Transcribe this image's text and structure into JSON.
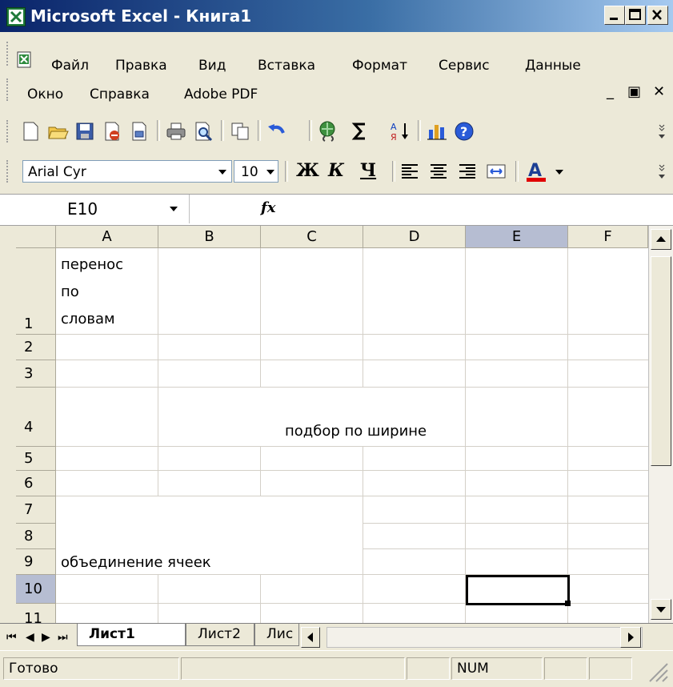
{
  "window": {
    "title": "Microsoft Excel - Книга1"
  },
  "menu": {
    "items": [
      "Файл",
      "Правка",
      "Вид",
      "Вставка",
      "Формат",
      "Сервис",
      "Данные"
    ],
    "items_row2": [
      "Окно",
      "Справка",
      "Adobe PDF"
    ]
  },
  "formatting": {
    "font_name": "Arial Cyr",
    "font_size": "10"
  },
  "formula_bar": {
    "name_box": "E10",
    "fx_label": "fx",
    "formula": ""
  },
  "sheet": {
    "columns": [
      "A",
      "B",
      "C",
      "D",
      "E",
      "F"
    ],
    "rows": [
      "1",
      "2",
      "3",
      "4",
      "5",
      "6",
      "7",
      "8",
      "9",
      "10",
      "11"
    ],
    "selected_column": "E",
    "selected_row": "10",
    "active_cell": "E10",
    "cells": {
      "A1_line1": "перенос",
      "A1_line2": "по",
      "A1_line3": "словам",
      "C4": "подбор по ширине",
      "A7_merged": "объединение ячеек"
    }
  },
  "tabs": {
    "items": [
      "Лист1",
      "Лист2",
      "Лис"
    ],
    "active": "Лист1"
  },
  "status": {
    "ready": "Готово",
    "num": "NUM"
  },
  "icons": {
    "app": "excel-icon",
    "new": "new-document-icon",
    "open": "open-folder-icon",
    "save": "save-icon",
    "permission": "permission-icon",
    "print": "print-icon",
    "print_preview": "print-preview-icon",
    "copy": "copy-icon",
    "undo": "undo-icon",
    "hyperlink": "hyperlink-icon",
    "autosum": "autosum-icon",
    "sort": "sort-ascending-icon",
    "chart": "chart-wizard-icon",
    "help": "help-icon"
  }
}
